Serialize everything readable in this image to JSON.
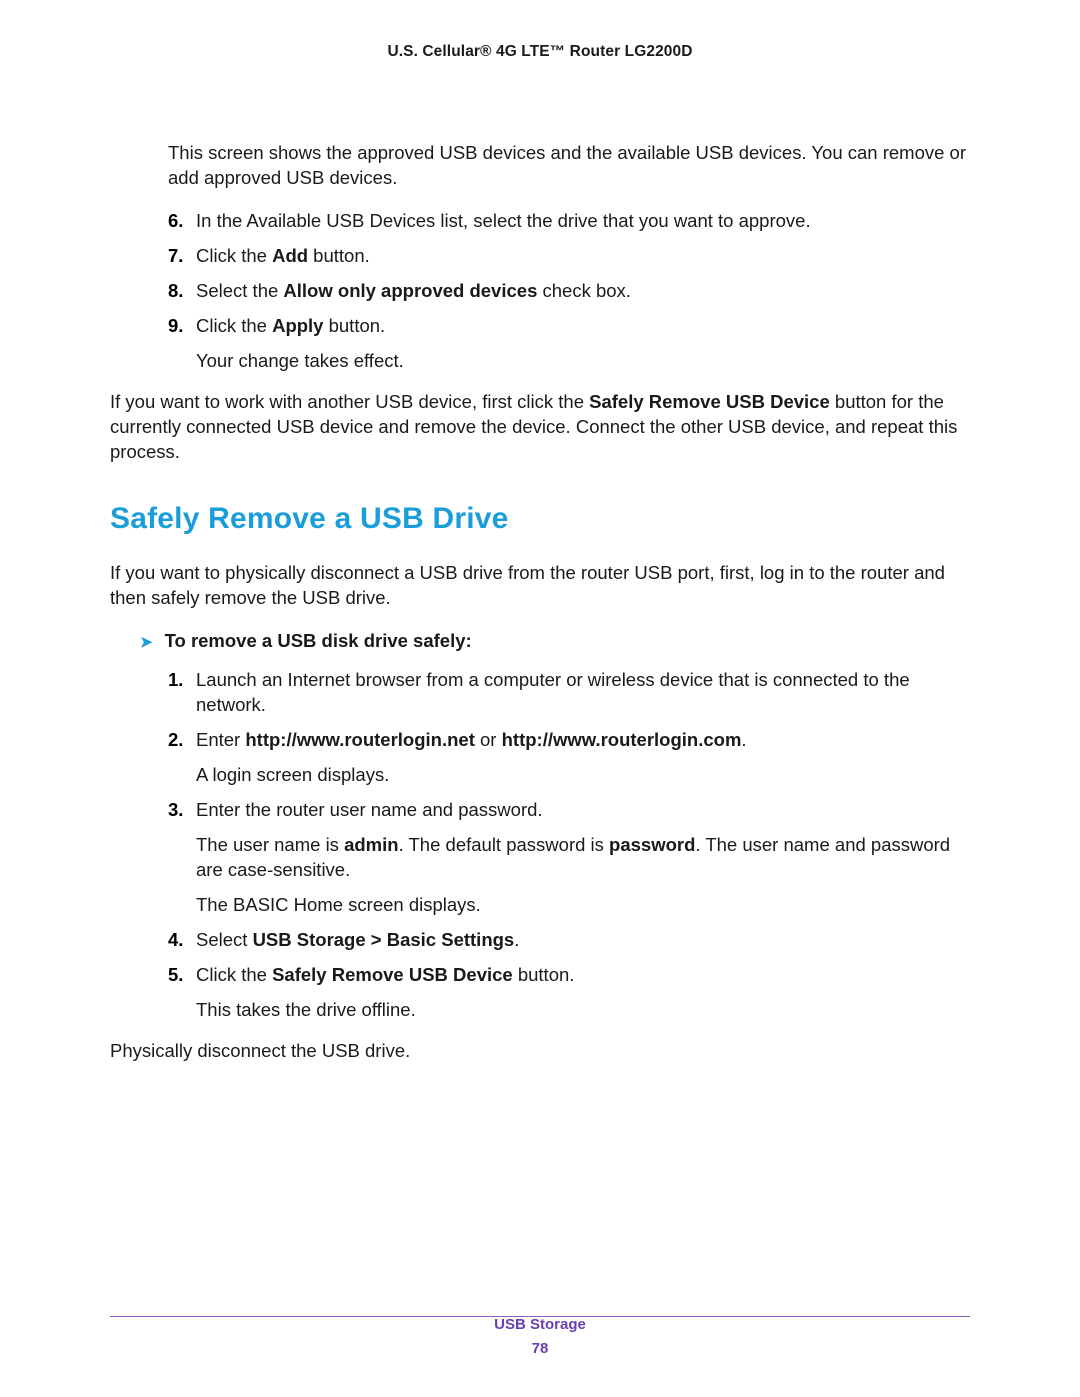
{
  "header": "U.S. Cellular® 4G LTE™ Router LG2200D",
  "intro_para": "This screen shows the approved USB devices and the available USB devices. You can remove or add approved USB devices.",
  "steps_a": {
    "s6": {
      "n": "6.",
      "t1": "In the Available USB Devices list, select the drive that you want to approve."
    },
    "s7": {
      "n": "7.",
      "t1": "Click the ",
      "b1": "Add",
      "t2": " button."
    },
    "s8": {
      "n": "8.",
      "t1": "Select the ",
      "b1": "Allow only approved devices",
      "t2": " check box."
    },
    "s9": {
      "n": "9.",
      "t1": "Click the ",
      "b1": "Apply",
      "t2": " button.",
      "sub": "Your change takes effect."
    }
  },
  "post_para": {
    "t1": "If you want to work with another USB device, first click the ",
    "b1": "Safely Remove USB Device",
    "t2": " button for the currently connected USB device and remove the device. Connect the other USB device, and repeat this process."
  },
  "section_title": "Safely Remove a USB Drive",
  "section_intro": "If you want to physically disconnect a USB drive from the router USB port, first, log in to the router and then safely remove the USB drive.",
  "proc_heading": "To remove a USB disk drive safely:",
  "steps_b": {
    "s1": {
      "n": "1.",
      "t1": "Launch an Internet browser from a computer or wireless device that is connected to the network."
    },
    "s2": {
      "n": "2.",
      "t1": "Enter ",
      "b1": "http://www.routerlogin.net",
      "t2": " or ",
      "b2": "http://www.routerlogin.com",
      "t3": ".",
      "sub": "A login screen displays."
    },
    "s3": {
      "n": "3.",
      "t1": "Enter the router user name and password.",
      "sub1": {
        "t1": "The user name is ",
        "b1": "admin",
        "t2": ". The default password is ",
        "b2": "password",
        "t3": ". The user name and password are case-sensitive."
      },
      "sub2": "The BASIC Home screen displays."
    },
    "s4": {
      "n": "4.",
      "t1": "Select ",
      "b1": "USB Storage > Basic Settings",
      "t2": "."
    },
    "s5": {
      "n": "5.",
      "t1": "Click the ",
      "b1": "Safely Remove USB Device",
      "t2": " button.",
      "sub": "This takes the drive offline."
    }
  },
  "closing_para": "Physically disconnect the USB drive.",
  "footer": {
    "section": "USB Storage",
    "page": "78"
  }
}
